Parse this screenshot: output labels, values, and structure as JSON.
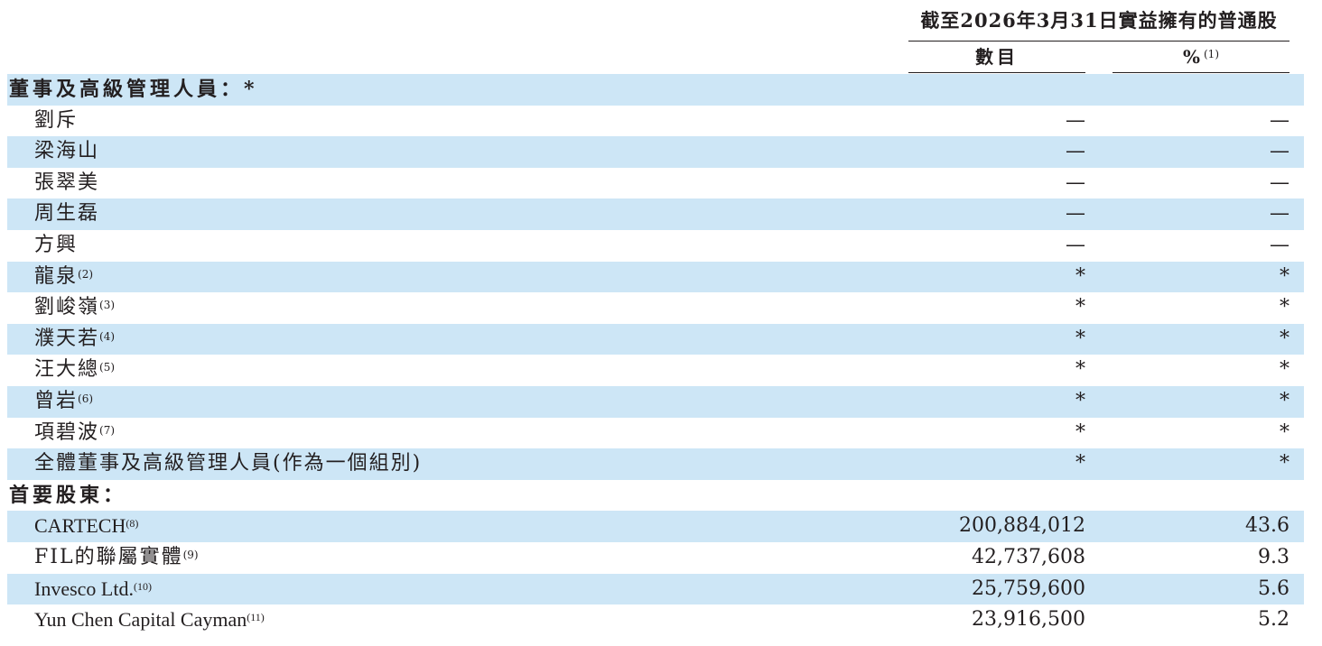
{
  "header": {
    "main": "截至2026年3月31日實益擁有的普通股",
    "col1": "數目",
    "col2": "%",
    "col2_note": "(1)"
  },
  "rows": [
    {
      "label": "董事及高級管理人員：*",
      "note": "",
      "v1": "",
      "v2": "",
      "section": true,
      "shaded": true
    },
    {
      "label": "劉斥",
      "note": "",
      "v1": "—",
      "v2": "—",
      "section": false,
      "shaded": false
    },
    {
      "label": "梁海山",
      "note": "",
      "v1": "—",
      "v2": "—",
      "section": false,
      "shaded": true
    },
    {
      "label": "張翠美",
      "note": "",
      "v1": "—",
      "v2": "—",
      "section": false,
      "shaded": false
    },
    {
      "label": "周生磊",
      "note": "",
      "v1": "—",
      "v2": "—",
      "section": false,
      "shaded": true
    },
    {
      "label": "方興",
      "note": "",
      "v1": "—",
      "v2": "—",
      "section": false,
      "shaded": false
    },
    {
      "label": "龍泉",
      "note": "(2)",
      "v1": "*",
      "v2": "*",
      "section": false,
      "shaded": true
    },
    {
      "label": "劉峻嶺",
      "note": "(3)",
      "v1": "*",
      "v2": "*",
      "section": false,
      "shaded": false
    },
    {
      "label": "濮天若",
      "note": "(4)",
      "v1": "*",
      "v2": "*",
      "section": false,
      "shaded": true
    },
    {
      "label": "汪大總",
      "note": "(5)",
      "v1": "*",
      "v2": "*",
      "section": false,
      "shaded": false
    },
    {
      "label": "曾岩",
      "note": "(6)",
      "v1": "*",
      "v2": "*",
      "section": false,
      "shaded": true
    },
    {
      "label": "項碧波",
      "note": "(7)",
      "v1": "*",
      "v2": "*",
      "section": false,
      "shaded": false
    },
    {
      "label": "全體董事及高級管理人員(作為一個組別)",
      "note": "",
      "v1": "*",
      "v2": "*",
      "section": false,
      "shaded": true
    },
    {
      "label": "首要股東：",
      "note": "",
      "v1": "",
      "v2": "",
      "section": true,
      "shaded": false
    },
    {
      "label": "CARTECH",
      "note": "(8)",
      "v1": "200,884,012",
      "v2": "43.6",
      "section": false,
      "shaded": true,
      "latin": true
    },
    {
      "label": "FIL的聯屬實體",
      "note": "(9)",
      "v1": "42,737,608",
      "v2": "9.3",
      "section": false,
      "shaded": false
    },
    {
      "label": "Invesco Ltd.",
      "note": "(10)",
      "v1": "25,759,600",
      "v2": "5.6",
      "section": false,
      "shaded": true,
      "latin": true
    },
    {
      "label": "Yun Chen Capital Cayman",
      "note": "(11)",
      "v1": "23,916,500",
      "v2": "5.2",
      "section": false,
      "shaded": false,
      "latin": true
    }
  ]
}
